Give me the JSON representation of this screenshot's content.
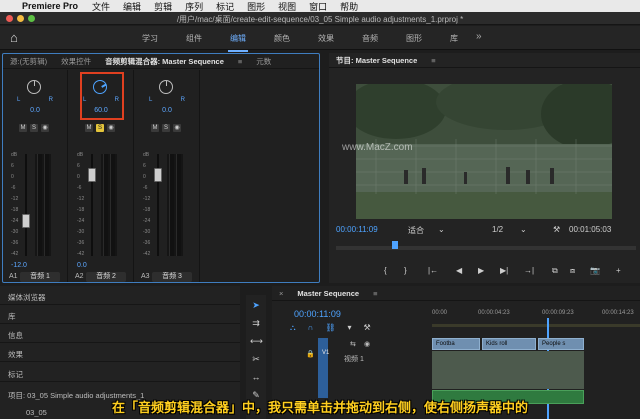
{
  "menubar": {
    "app": "Premiere Pro",
    "items": [
      "文件",
      "编辑",
      "剪辑",
      "序列",
      "标记",
      "图形",
      "视图",
      "窗口",
      "帮助"
    ]
  },
  "titlebar": {
    "path": "/用户/mac/桌面/create-edit-sequence/03_05 Simple audio adjustments_1.prproj *"
  },
  "workspaces": {
    "tabs": [
      "学习",
      "组件",
      "编辑",
      "颜色",
      "效果",
      "音频",
      "图形",
      "库"
    ],
    "active": "编辑",
    "more": "»"
  },
  "mixer": {
    "tabs": [
      "源:(无剪辑)",
      "效果控件",
      "音频剪辑混合器: Master Sequence",
      "元数"
    ],
    "menu": "≡",
    "db_scale": [
      "dB",
      "6",
      "0",
      "-6",
      "-12",
      "-18",
      "-24",
      "-30",
      "-36",
      "-42",
      "-48",
      "-54",
      "-∞"
    ],
    "tracks": [
      {
        "id": "A1",
        "name": "音频 1",
        "pan": "0.0",
        "fader": "-12.0",
        "l": "L",
        "r": "R",
        "mute": "M",
        "solo": "S",
        "rec": "◉"
      },
      {
        "id": "A2",
        "name": "音频 2",
        "pan": "60.0",
        "fader": "0.0",
        "l": "L",
        "r": "R",
        "mute": "M",
        "solo": "S",
        "rec": "◉"
      },
      {
        "id": "A3",
        "name": "音频 3",
        "pan": "0.0",
        "fader": "",
        "l": "L",
        "r": "R",
        "mute": "M",
        "solo": "S",
        "rec": "◉"
      }
    ]
  },
  "program": {
    "tab": "节目: Master Sequence",
    "menu": "≡",
    "timecode_current": "00:00:11:09",
    "fit": "适合",
    "quality": "1/2",
    "timecode_total": "00:01:05:03",
    "controls": [
      "{",
      "}",
      "|←",
      "◀",
      "▶",
      "▶|",
      "→|",
      "⧉",
      "⧈",
      "📷",
      "+"
    ]
  },
  "browser": {
    "items": [
      "媒体浏览器",
      "库",
      "信息",
      "效果",
      "标记"
    ],
    "project": "项目: 03_05 Simple audio adjustments_1",
    "project_file": "03_05"
  },
  "timeline": {
    "tab": "Master Sequence",
    "menu": "≡",
    "timecode": "00:00:11:09",
    "ruler": [
      "00:00",
      "00:00:04:23",
      "00:00:09:23",
      "00:00:14:23"
    ],
    "v1": "V1",
    "video_label": "视频 1",
    "clips": [
      "Footba",
      "Kids roll",
      "People s"
    ]
  },
  "subtitle": "在「音频剪辑混合器」中，我只需单击并拖动到右侧，使右侧扬声器中的",
  "watermark": "www.MacZ.com",
  "colors": {
    "accent": "#4ea3ff",
    "highlight": "#e04020",
    "subtitle": "#ffcf1f"
  }
}
